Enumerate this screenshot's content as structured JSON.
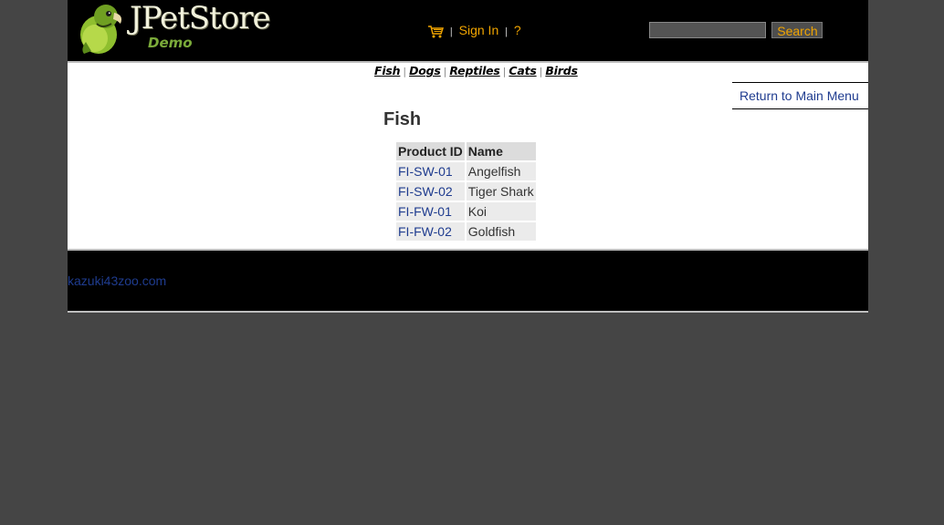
{
  "header": {
    "logo_title": "JPetStore",
    "logo_subtitle": "Demo",
    "sign_in_label": "Sign In",
    "help_label": "?",
    "separator": "|",
    "search": {
      "value": "",
      "placeholder": "",
      "button_label": "Search"
    }
  },
  "quick_links": [
    {
      "label": "Fish"
    },
    {
      "label": "Dogs"
    },
    {
      "label": "Reptiles"
    },
    {
      "label": "Cats"
    },
    {
      "label": "Birds"
    }
  ],
  "back_link": "Return to Main Menu",
  "category": {
    "title": "Fish",
    "columns": [
      "Product ID",
      "Name"
    ],
    "rows": [
      {
        "id": "FI-SW-01",
        "name": "Angelfish"
      },
      {
        "id": "FI-SW-02",
        "name": "Tiger Shark"
      },
      {
        "id": "FI-FW-01",
        "name": "Koi"
      },
      {
        "id": "FI-FW-02",
        "name": "Goldfish"
      }
    ]
  },
  "footer": {
    "link": "kazuki43zoo.com"
  },
  "colors": {
    "accent": "#f0a400",
    "link": "#1f3c8f",
    "header_bg": "#000000",
    "page_bg": "#454545"
  },
  "icons": [
    "parrot-logo",
    "cart-icon"
  ]
}
